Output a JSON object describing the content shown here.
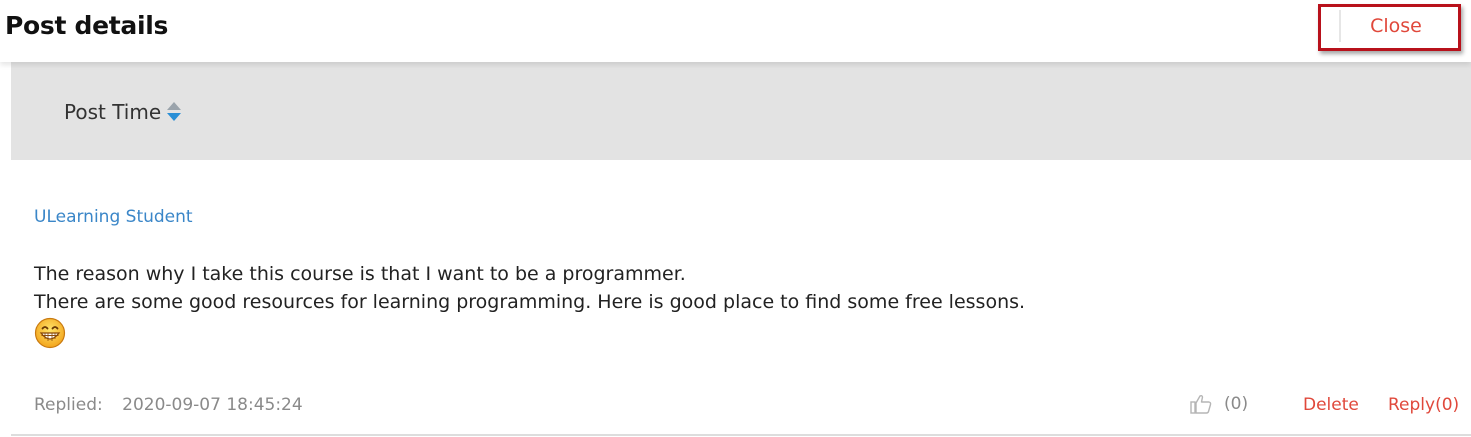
{
  "header": {
    "title": "Post details",
    "close_label": "Close"
  },
  "filter": {
    "sort_label": "Post Time",
    "sort_icon": "sort-arrows-icon",
    "sort_direction": "descending"
  },
  "post": {
    "author": "ULearning Student",
    "lines": [
      "The reason why I take this course is that I want to be a programmer.",
      "There are some good resources for learning programming. Here is good place to find some free lessons."
    ],
    "emoji": "grinning-face-icon",
    "replied_label": "Replied:",
    "replied_time": "2020-09-07 18:45:24",
    "like_icon": "thumbs-up-icon",
    "like_count": "(0)",
    "delete_label": "Delete",
    "reply_label": "Reply(0)"
  },
  "colors": {
    "accent_red": "#e0483b",
    "highlight_border": "#b8111b",
    "link_blue": "#3a86c8",
    "sort_active": "#2a8fd6",
    "filter_bg": "#e3e3e3"
  }
}
